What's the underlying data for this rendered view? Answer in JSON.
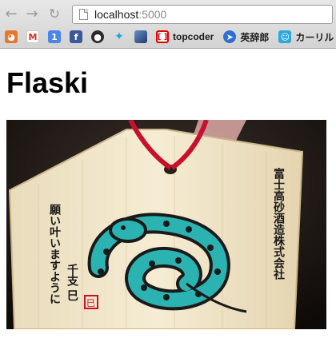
{
  "browser": {
    "url_host": "localhost",
    "url_port": ":5000",
    "bookmarks": [
      {
        "icon": "rss-icon",
        "label": ""
      },
      {
        "icon": "gmail-icon",
        "label": ""
      },
      {
        "icon": "google-calendar-icon",
        "label": ""
      },
      {
        "icon": "facebook-icon",
        "label": ""
      },
      {
        "icon": "github-icon",
        "label": ""
      },
      {
        "icon": "twitter-icon",
        "label": ""
      },
      {
        "icon": "photo-icon",
        "label": ""
      },
      {
        "icon": "topcoder-icon",
        "label": "topcoder"
      },
      {
        "icon": "eijiro-icon",
        "label": "英辞郎"
      },
      {
        "icon": "cat-icon",
        "label": "カーリル"
      }
    ]
  },
  "page": {
    "title": "Flaski"
  },
  "photo": {
    "subject": "wooden-ema-plaque-with-snake",
    "text_right": "富士高砂酒造株式会社",
    "text_left1": "願い叶いますように",
    "text_left2": "千支 巳",
    "stamp": "巳"
  },
  "colors": {
    "chrome_bg": "#d9d9d9",
    "snake_teal": "#2bb3b1",
    "cord_red": "#c8102e",
    "wood": "#f2e7c9"
  }
}
